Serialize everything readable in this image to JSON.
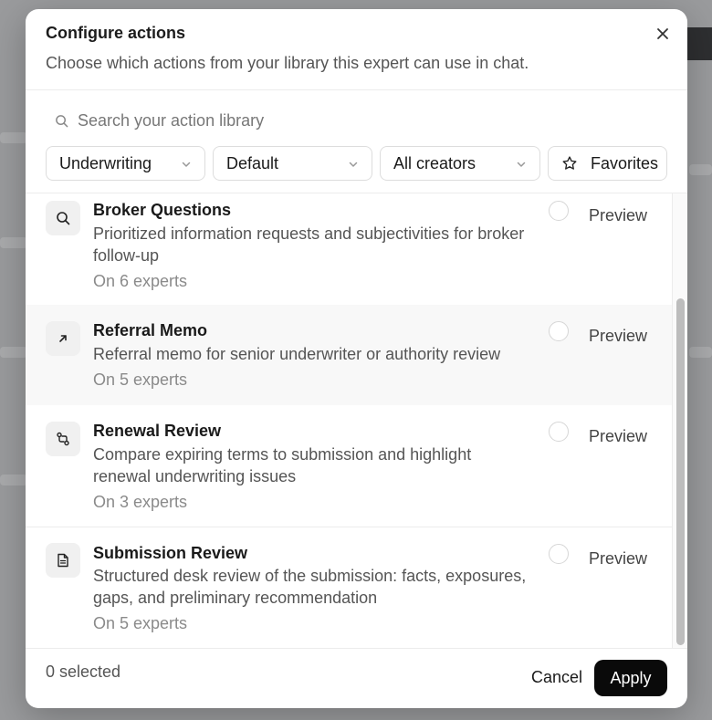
{
  "dialog": {
    "title": "Configure actions",
    "subtitle": "Choose which actions from your library this expert can use in chat."
  },
  "search": {
    "placeholder": "Search your action library",
    "value": ""
  },
  "filters": {
    "category": "Underwriting",
    "sort": "Default",
    "creator": "All creators",
    "favorites_label": "Favorites"
  },
  "actions": [
    {
      "icon": "search-icon",
      "title": "Broker Questions",
      "description": "Prioritized information requests and subjectivities for broker follow-up",
      "meta": "On 6 experts",
      "preview_label": "Preview",
      "selected": false
    },
    {
      "icon": "arrow-up-right-icon",
      "title": "Referral Memo",
      "description": "Referral memo for senior underwriter or authority review",
      "meta": "On 5 experts",
      "preview_label": "Preview",
      "selected": false
    },
    {
      "icon": "git-compare-icon",
      "title": "Renewal Review",
      "description": "Compare expiring terms to submission and highlight renewal underwriting issues",
      "meta": "On 3 experts",
      "preview_label": "Preview",
      "selected": false
    },
    {
      "icon": "document-icon",
      "title": "Submission Review",
      "description": "Structured desk review of the submission: facts, exposures, gaps, and preliminary recommendation",
      "meta": "On 5 experts",
      "preview_label": "Preview",
      "selected": false
    }
  ],
  "footer": {
    "selected_count": "0 selected",
    "cancel_label": "Cancel",
    "apply_label": "Apply"
  },
  "colors": {
    "primary_button": "#0a0a0a",
    "hover_row": "#f8f8f8"
  }
}
